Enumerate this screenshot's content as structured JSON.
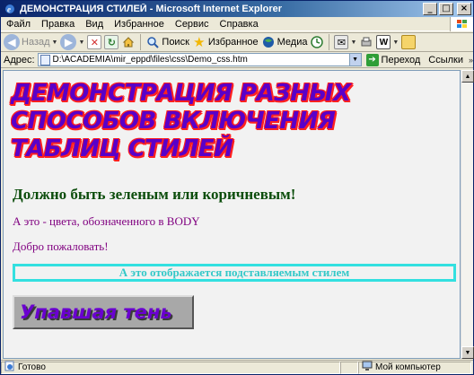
{
  "window": {
    "title": "ДЕМОНСТРАЦИЯ СТИЛЕЙ - Microsoft Internet Explorer"
  },
  "menu": [
    {
      "label": "Файл"
    },
    {
      "label": "Правка"
    },
    {
      "label": "Вид"
    },
    {
      "label": "Избранное"
    },
    {
      "label": "Сервис"
    },
    {
      "label": "Справка"
    }
  ],
  "toolbar": {
    "back_label": "Назад",
    "search_label": "Поиск",
    "favorites_label": "Избранное",
    "media_label": "Медиа"
  },
  "address": {
    "label": "Адрес:",
    "value": "D:\\ACADEMIA\\mir_eppd\\files\\css\\Demo_css.htm",
    "go_label": "Переход",
    "links_label": "Ссылки"
  },
  "content": {
    "heading_line1": "ДЕМОНСТРАЦИЯ РАЗНЫХ",
    "heading_line2": "СПОСОБОВ ВКЛЮЧЕНИЯ",
    "heading_line3": "ТАБЛИЦ СТИЛЕЙ",
    "green_heading": "Должно быть зеленым или коричневым!",
    "purple_line1": "А это - цвета, обозначенного в BODY",
    "purple_line2": "Добро пожаловать!",
    "boxed_text": "А это отображается подставляемым стилем",
    "shadow_text": "Упавшая тень"
  },
  "status": {
    "left": "Готово",
    "zone": "Мой компьютер"
  },
  "colors": {
    "heading_fill": "#5A00C8",
    "heading_outline": "#FF2020",
    "green_heading": "#0B4D0B",
    "body_text": "#800080",
    "boxed": "#33E0E0"
  }
}
